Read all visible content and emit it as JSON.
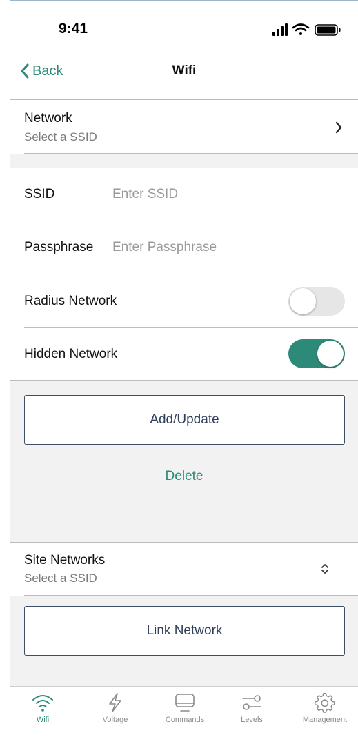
{
  "status_bar": {
    "time": "9:41"
  },
  "nav": {
    "back_label": "Back",
    "title": "Wifi"
  },
  "network": {
    "title": "Network",
    "subtitle": "Select a SSID"
  },
  "form": {
    "ssid_label": "SSID",
    "ssid_value": "",
    "ssid_placeholder": "Enter SSID",
    "passphrase_label": "Passphrase",
    "passphrase_value": "",
    "passphrase_placeholder": "Enter Passphrase",
    "radius_label": "Radius Network",
    "radius_on": false,
    "hidden_label": "Hidden Network",
    "hidden_on": true
  },
  "actions": {
    "add_update_label": "Add/Update",
    "delete_label": "Delete"
  },
  "site_networks": {
    "title": "Site Networks",
    "subtitle": "Select a SSID",
    "link_label": "Link Network"
  },
  "tabs": [
    {
      "label": "Wifi",
      "icon": "wifi-icon",
      "active": true
    },
    {
      "label": "Voltage",
      "icon": "lightning-icon",
      "active": false
    },
    {
      "label": "Commands",
      "icon": "monitor-icon",
      "active": false
    },
    {
      "label": "Levels",
      "icon": "sliders-icon",
      "active": false
    },
    {
      "label": "Management",
      "icon": "gear-icon",
      "active": false
    }
  ],
  "colors": {
    "accent": "#2e8a78",
    "button_text": "#2f3f5a",
    "band": "#f2f2f2"
  }
}
